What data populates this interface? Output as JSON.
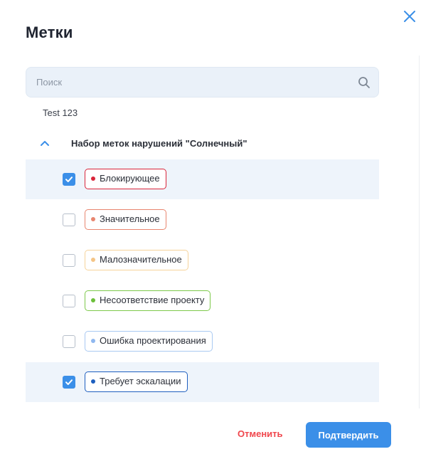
{
  "dialog": {
    "title": "Метки",
    "close_icon": "close-icon"
  },
  "search": {
    "placeholder": "Поиск",
    "value": "",
    "icon": "search-icon"
  },
  "ungrouped_labels": [
    "Test 123"
  ],
  "group": {
    "title": "Набор меток нарушений \"Солнечный\"",
    "expanded": true,
    "chevron_icon": "chevron-up-icon",
    "items": [
      {
        "label": "Блокирующее",
        "checked": true,
        "color": "#d9253a",
        "dot": "#d9253a"
      },
      {
        "label": "Значительное",
        "checked": false,
        "color": "#e8866f",
        "dot": "#e8866f"
      },
      {
        "label": "Малозначительное",
        "checked": false,
        "color": "#f6d39a",
        "dot": "#f4c486"
      },
      {
        "label": "Несоответствие проекту",
        "checked": false,
        "color": "#7dc94a",
        "dot": "#6cbf3a"
      },
      {
        "label": "Ошибка проектирования",
        "checked": false,
        "color": "#a9c9f2",
        "dot": "#8fb8ef"
      },
      {
        "label": "Требует эскалации",
        "checked": true,
        "color": "#1e5fbf",
        "dot": "#1e5fbf"
      }
    ]
  },
  "footer": {
    "cancel_label": "Отменить",
    "confirm_label": "Подтвердить"
  },
  "colors": {
    "accent": "#3b8fe8",
    "danger": "#f0464c",
    "selected_row": "#eef4fb"
  }
}
